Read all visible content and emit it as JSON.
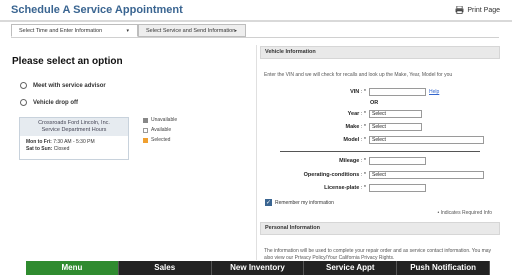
{
  "header": {
    "title": "Schedule A Service Appointment",
    "print_label": "Print Page"
  },
  "tabs": [
    {
      "label": "Select Time and Enter Information",
      "caret": "▾"
    },
    {
      "label": "Select Service and Send Information",
      "caret": "▸"
    }
  ],
  "left": {
    "heading": "Please select an option",
    "options": [
      {
        "label": "Meet with service advisor"
      },
      {
        "label": "Vehicle drop off"
      }
    ],
    "hours": {
      "dealer": "Crossroads Ford Lincoln, Inc.",
      "subtitle": "Service Department Hours",
      "weekday_days": "Mon to Fri:",
      "weekday_hours": "7:30 AM - 5:30 PM",
      "weekend_days": "Sat to Sun:",
      "weekend_hours": "Closed"
    },
    "legend": [
      {
        "label": "Unavailable",
        "color": "#888888"
      },
      {
        "label": "Available",
        "color": "#ffffff"
      },
      {
        "label": "Selected",
        "color": "#f0a030"
      }
    ]
  },
  "vehicle": {
    "panel_title": "Vehicle Information",
    "intro": "Enter the VIN and we will check for recalls and look up the Make, Year, Model for you",
    "vin_label": "VIN",
    "vin_value": "",
    "help_link": "Help",
    "or_label": "OR",
    "year_label": "Year",
    "year_value": "Select",
    "make_label": "Make",
    "make_value": "Select",
    "model_label": "Model",
    "model_value": "Select",
    "mileage_label": "Mileage",
    "mileage_value": "",
    "conditions_label": "Operating-conditions",
    "conditions_value": "Select",
    "plate_label": "License-plate",
    "plate_value": "",
    "remember_label": "Remember my information",
    "required_note": "• Indicates Required Info"
  },
  "personal": {
    "panel_title": "Personal Information",
    "info_text": "The information will be used to complete your repair order and as service contact information. You may also view our Privacy Policy/Your California Privacy Rights."
  },
  "bottom_nav": [
    {
      "label": "Menu"
    },
    {
      "label": "Sales"
    },
    {
      "label": "New Inventory"
    },
    {
      "label": "Service Appt"
    },
    {
      "label": "Push Notification"
    }
  ],
  "colors": {
    "title": "#3a6591",
    "menu_green": "#2f8b2f",
    "nav_dark": "#222222"
  }
}
